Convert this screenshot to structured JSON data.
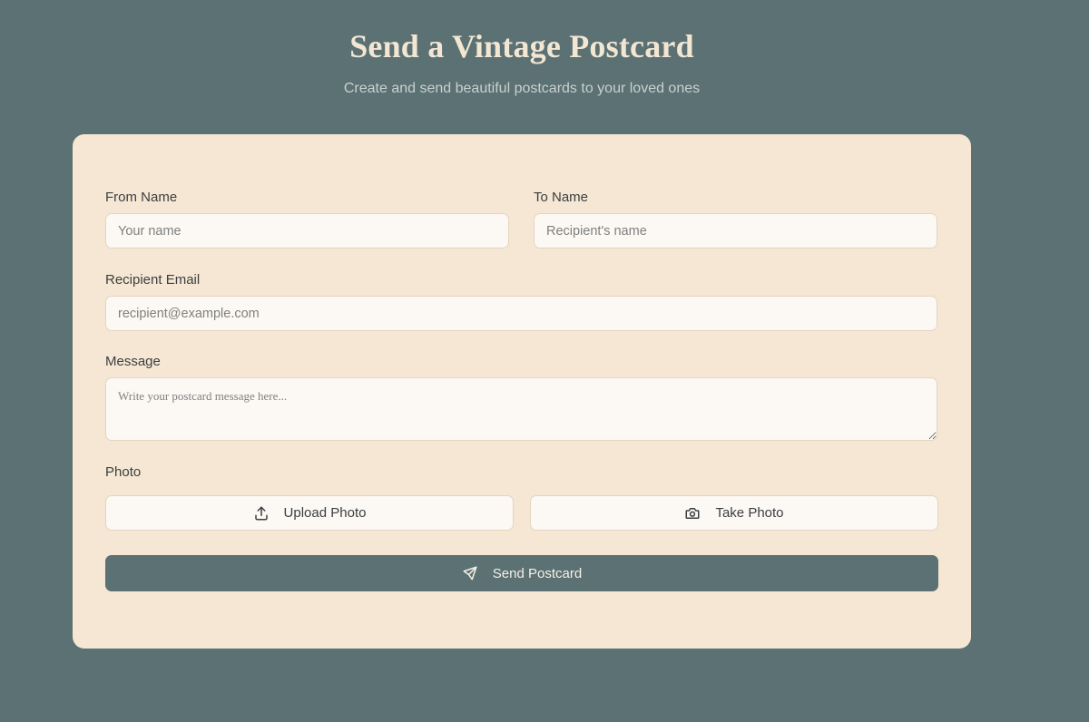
{
  "header": {
    "title": "Send a Vintage Postcard",
    "subtitle": "Create and send beautiful postcards to your loved ones"
  },
  "form": {
    "from_name": {
      "label": "From Name",
      "placeholder": "Your name",
      "value": ""
    },
    "to_name": {
      "label": "To Name",
      "placeholder": "Recipient's name",
      "value": ""
    },
    "recipient_email": {
      "label": "Recipient Email",
      "placeholder": "recipient@example.com",
      "value": ""
    },
    "message": {
      "label": "Message",
      "placeholder": "Write your postcard message here...",
      "value": ""
    },
    "photo": {
      "label": "Photo",
      "upload_label": "Upload Photo",
      "upload_icon": "upload-icon",
      "take_label": "Take Photo",
      "take_icon": "camera-icon"
    },
    "submit": {
      "label": "Send Postcard",
      "icon": "send-icon"
    }
  },
  "colors": {
    "background": "#5b7173",
    "card": "#f5e7d3",
    "input_background": "#fcf8f3",
    "primary_button": "#5b7173"
  }
}
